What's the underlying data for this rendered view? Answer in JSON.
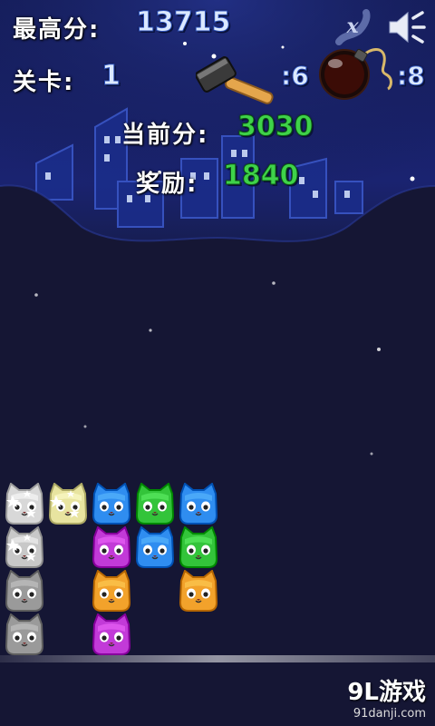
{
  "hud": {
    "high_score_label": "最高分:",
    "high_score": "13715",
    "level_label": "关卡:",
    "level": "1",
    "hammer_count": ":6",
    "bomb_count": ":8",
    "current_score_label": "当前分:",
    "current_score": "3030",
    "bonus_label": "奖励:",
    "bonus": "1840"
  },
  "icons": {
    "close": "x-close-icon",
    "sound": "speaker-mute-icon",
    "hammer": "hammer-icon",
    "bomb": "bomb-icon"
  },
  "board": {
    "tiles": [
      {
        "col": 0,
        "row": 0,
        "color": "#9a9a9a",
        "state": "gray"
      },
      {
        "col": 0,
        "row": 1,
        "color": "#9a9a9a",
        "state": "gray"
      },
      {
        "col": 0,
        "row": 2,
        "color": "#c8c8c8",
        "state": "sparkle"
      },
      {
        "col": 0,
        "row": 3,
        "color": "#d8d8d8",
        "state": "sparkle"
      },
      {
        "col": 1,
        "row": 3,
        "color": "#e8e4a0",
        "state": "sparkle"
      },
      {
        "col": 2,
        "row": 0,
        "color": "#c23ad8",
        "state": "cat"
      },
      {
        "col": 2,
        "row": 1,
        "color": "#f2a22b",
        "state": "cat"
      },
      {
        "col": 2,
        "row": 2,
        "color": "#c23ad8",
        "state": "cat"
      },
      {
        "col": 2,
        "row": 3,
        "color": "#2f8df0",
        "state": "cat"
      },
      {
        "col": 3,
        "row": 2,
        "color": "#2f8df0",
        "state": "cat"
      },
      {
        "col": 3,
        "row": 3,
        "color": "#33c43a",
        "state": "cat"
      },
      {
        "col": 4,
        "row": 1,
        "color": "#f2a22b",
        "state": "cat"
      },
      {
        "col": 4,
        "row": 2,
        "color": "#33c43a",
        "state": "cat"
      },
      {
        "col": 4,
        "row": 3,
        "color": "#2f8df0",
        "state": "cat"
      }
    ]
  },
  "watermark": {
    "main": "9L游戏",
    "sub": "91danji.com"
  }
}
